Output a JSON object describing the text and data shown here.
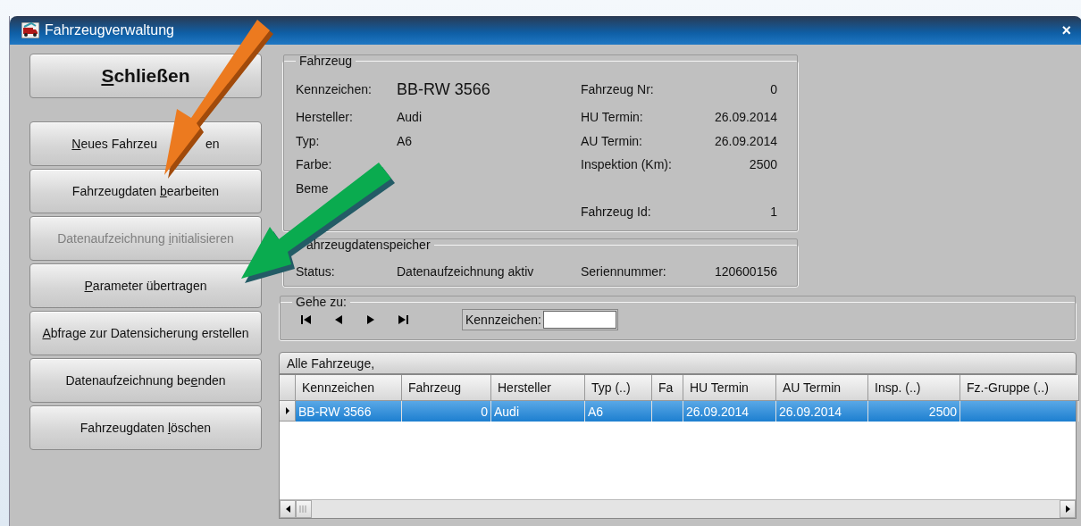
{
  "window": {
    "title": "Fahrzeugverwaltung",
    "close": "×"
  },
  "close_button": {
    "key": "S",
    "post": "chließen"
  },
  "actions": [
    {
      "key": "N",
      "post": "eues Fahrzeu",
      "tail": "en",
      "disabled": false
    },
    {
      "pre": "Fahrzeugdaten ",
      "key": "b",
      "post": "earbeiten",
      "disabled": false
    },
    {
      "pre": "Datenaufzeichnung ",
      "key": "i",
      "post": "nitialisieren",
      "disabled": true
    },
    {
      "key": "P",
      "post": "arameter übertragen",
      "disabled": false
    },
    {
      "key": "A",
      "post": "bfrage zur Datensicherung erstellen",
      "disabled": false
    },
    {
      "pre": "Datenaufzeichnung be",
      "key": "e",
      "post": "nden",
      "disabled": false
    },
    {
      "pre": "Fahrzeugdaten ",
      "key": "l",
      "post": "öschen",
      "disabled": false
    }
  ],
  "vehicle": {
    "title": "Fahrzeug",
    "rows": [
      {
        "left": {
          "label": "Kennzeichen:",
          "value": "BB-RW 3566",
          "kind": "large"
        },
        "right": {
          "label": "Fahrzeug Nr:",
          "value": "0"
        }
      },
      {
        "left": {
          "label": "Hersteller:",
          "value": "Audi"
        },
        "right": {
          "label": "HU Termin:",
          "value": "26.09.2014"
        }
      },
      {
        "left": {
          "label": "Typ:",
          "value": "A6"
        },
        "right": {
          "label": "AU Termin:",
          "value": "26.09.2014"
        }
      },
      {
        "left": {
          "label": "Farbe:"
        },
        "right": {
          "label": "Inspektion (Km):",
          "value": "2500"
        }
      },
      {
        "left": {
          "label": "Beme"
        }
      },
      {
        "right": {
          "label": "Fahrzeug Id:",
          "value": "1"
        }
      }
    ]
  },
  "storage": {
    "title": "ahrzeugdatenspeicher",
    "status_label": "Status:",
    "status": "Datenaufzeichnung aktiv",
    "serial_label": "Seriennummer:",
    "serial": "120600156"
  },
  "goto": {
    "title": "Gehe zu:",
    "field_label": "Kennzeichen:"
  },
  "list": {
    "title": "Alle Fahrzeuge,",
    "columns": [
      "Kennzeichen",
      "Fahrzeug",
      "Hersteller",
      "Typ (..)",
      "Fa",
      "HU Termin",
      "AU Termin",
      "Insp. (..)",
      "Fz.-Gruppe (..)"
    ],
    "rows": [
      {
        "selected": true,
        "cells": [
          "BB-RW 3566",
          "0",
          "Audi",
          "A6",
          "",
          "26.09.2014",
          "26.09.2014",
          "2500",
          ""
        ]
      }
    ]
  }
}
